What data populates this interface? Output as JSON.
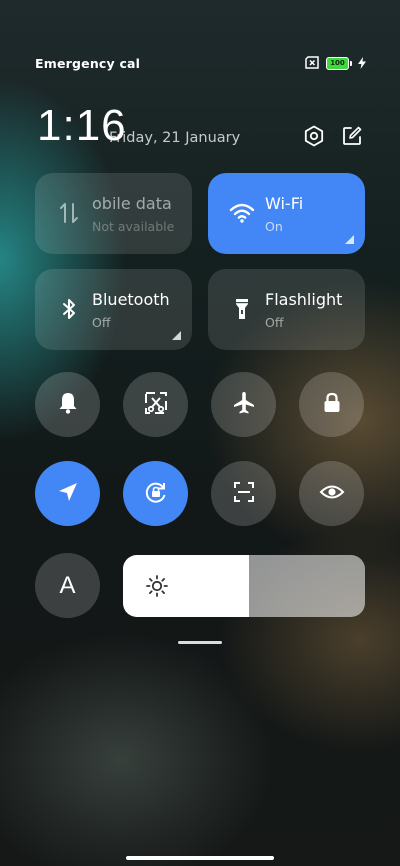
{
  "status_bar": {
    "carrier_text": "Emergency calls o",
    "battery_level": "100"
  },
  "header": {
    "time": "1:16",
    "date": "Friday, 21 January"
  },
  "tiles": {
    "mobile_data": {
      "label": "obile data",
      "status": "Not available"
    },
    "wifi": {
      "label": "Wi-Fi",
      "status": "On"
    },
    "bluetooth": {
      "label": "Bluetooth",
      "status": "Off"
    },
    "flashlight": {
      "label": "Flashlight",
      "status": "Off"
    }
  },
  "quick_toggles": [
    {
      "name": "bell-icon",
      "active": false
    },
    {
      "name": "screenshot-icon",
      "active": false
    },
    {
      "name": "airplane-icon",
      "active": false
    },
    {
      "name": "lock-icon",
      "active": false
    },
    {
      "name": "location-icon",
      "active": true
    },
    {
      "name": "rotation-lock-icon",
      "active": true
    },
    {
      "name": "scanner-icon",
      "active": false
    },
    {
      "name": "eye-icon",
      "active": false
    }
  ],
  "font_button": {
    "label": "A"
  },
  "brightness": {
    "level": 0.52
  },
  "colors": {
    "accent": "#4287f5",
    "battery": "#3fd83f"
  }
}
